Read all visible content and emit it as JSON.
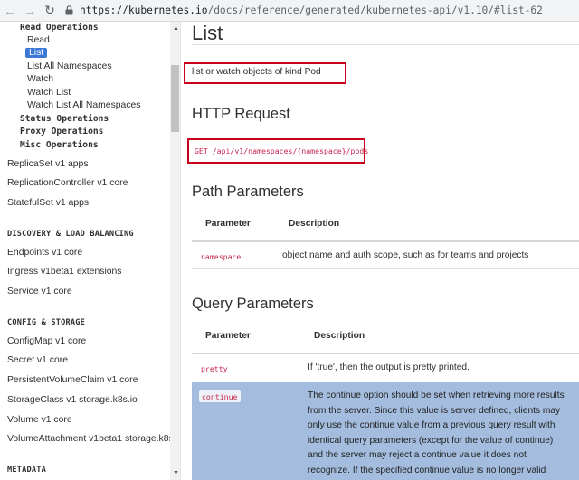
{
  "browser": {
    "url_host": "https://kubernetes.io",
    "url_path": "/docs/reference/generated/kubernetes-api/v1.10/#list-62"
  },
  "sidebar": {
    "operations": [
      {
        "label": "Read Operations"
      },
      {
        "label": "Status Operations"
      },
      {
        "label": "Proxy Operations"
      },
      {
        "label": "Misc Operations"
      }
    ],
    "read_items": [
      "Read",
      "List",
      "List All Namespaces",
      "Watch",
      "Watch List",
      "Watch List All Namespaces"
    ],
    "active_item": "List",
    "resources_top": [
      "ReplicaSet v1 apps",
      "ReplicationController v1 core",
      "StatefulSet v1 apps"
    ],
    "categories": [
      "DISCOVERY & LOAD BALANCING",
      "CONFIG & STORAGE",
      "METADATA"
    ],
    "discovery_items": [
      "Endpoints v1 core",
      "Ingress v1beta1 extensions",
      "Service v1 core"
    ],
    "config_items": [
      "ConfigMap v1 core",
      "Secret v1 core",
      "PersistentVolumeClaim v1 core",
      "StorageClass v1 storage.k8s.io",
      "Volume v1 core",
      "VolumeAttachment v1beta1 storage.k8s"
    ]
  },
  "main": {
    "title": "List",
    "description": "list or watch objects of kind Pod",
    "http_request_heading": "HTTP Request",
    "http_request": "GET /api/v1/namespaces/{namespace}/pods",
    "path_params_heading": "Path Parameters",
    "path_params_header": {
      "param": "Parameter",
      "desc": "Description"
    },
    "path_params": [
      {
        "name": "namespace",
        "desc": "object name and auth scope, such as for teams and projects"
      }
    ],
    "query_params_heading": "Query Parameters",
    "query_params_header": {
      "param": "Parameter",
      "desc": "Description"
    },
    "query_params": [
      {
        "name": "pretty",
        "desc": "If 'true', then the output is pretty printed."
      },
      {
        "name": "continue",
        "desc": "The continue option should be set when retrieving more results from the server. Since this value is server defined, clients may only use the continue value from a previous query result with identical query parameters (except for the value of continue) and the server may reject a continue value it does not recognize. If the specified continue value is no longer valid whether due to"
      }
    ]
  },
  "colors": {
    "highlight_row": "#a4bdde",
    "annotation_box": "#c8001e",
    "active_item": "#3c78d8",
    "code_text": "#c7254e"
  }
}
